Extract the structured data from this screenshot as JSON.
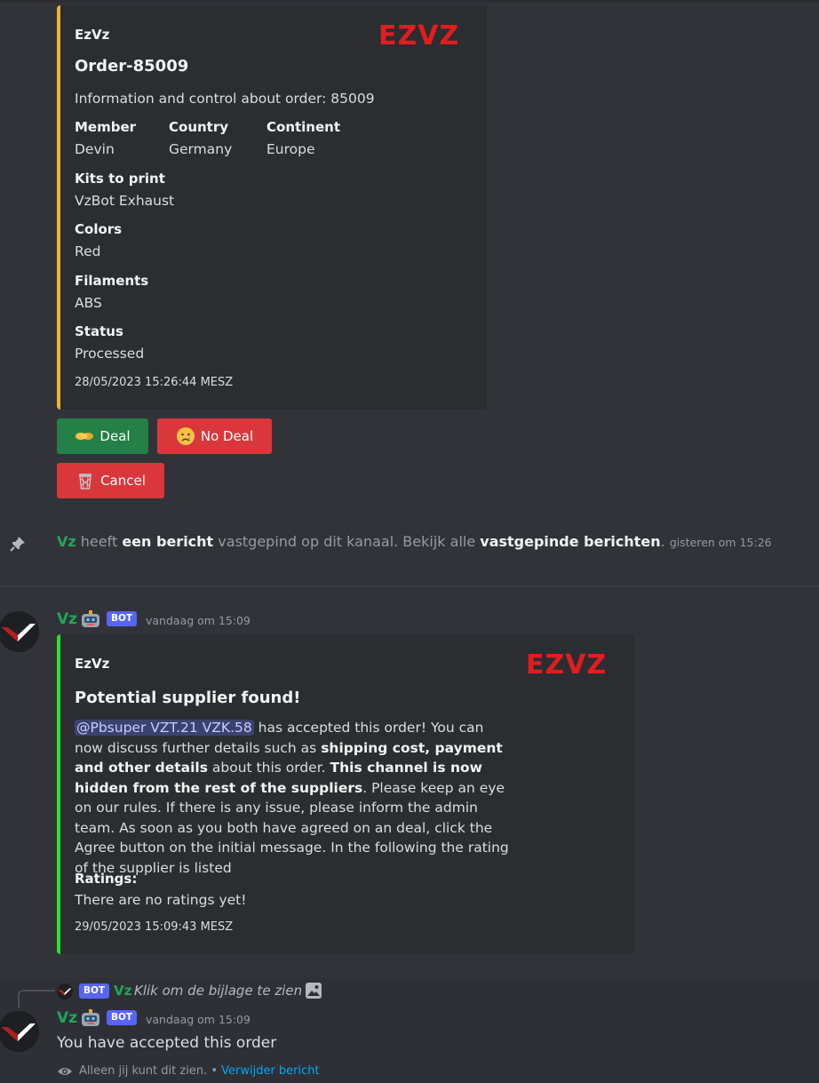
{
  "order_embed": {
    "author": "EzVz",
    "logo_text": "EZVZ",
    "title": "Order-85009",
    "description": "Information and control about order: 85009",
    "fields": {
      "member": {
        "name": "Member",
        "value": "Devin"
      },
      "country": {
        "name": "Country",
        "value": "Germany"
      },
      "continent": {
        "name": "Continent",
        "value": "Europe"
      },
      "kits": {
        "name": "Kits to print",
        "value": "VzBot Exhaust"
      },
      "colors": {
        "name": "Colors",
        "value": "Red"
      },
      "filaments": {
        "name": "Filaments",
        "value": "ABS"
      },
      "status": {
        "name": "Status",
        "value": "Processed"
      }
    },
    "footer": "28/05/2023 15:26:44 MESZ",
    "bar_color": "#f0b232"
  },
  "buttons": {
    "deal": "Deal",
    "no_deal": "No Deal",
    "cancel": "Cancel"
  },
  "pin_message": {
    "user": "Vz",
    "part1": " heeft ",
    "bold1": "een bericht",
    "part2": " vastgepind op dit kanaal. Bekijk alle ",
    "bold2": "vastgepinde berichten",
    "part3": ".",
    "timestamp": "gisteren om 15:26"
  },
  "message1": {
    "username": "Vz",
    "badge": "BOT",
    "timestamp": "vandaag om 15:09"
  },
  "supplier_embed": {
    "author": "EzVz",
    "logo_text": "EZVZ",
    "title": "Potential supplier found!",
    "mention": "@Pbsuper VZT.21 VZK.58",
    "text1": " has accepted this order! You can now discuss further details such as ",
    "bold1": "shipping cost, payment and other details",
    "text2": " about this order. ",
    "bold2": "This channel is now hidden from the rest of the suppliers",
    "text3": ". Please keep an eye on our rules. If there is any issue, please inform the admin team. As soon as you both have agreed on an deal, click the Agree button on the initial message. In the following the rating of the supplier is listed",
    "ratings_name": "Ratings:",
    "ratings_value": "There are no ratings yet!",
    "footer": "29/05/2023 15:09:43 MESZ",
    "bar_color": "#23e52b"
  },
  "reply": {
    "badge": "BOT",
    "username": "Vz",
    "text": "Klik om de bijlage te zien"
  },
  "message2": {
    "username": "Vz",
    "badge": "BOT",
    "timestamp": "vandaag om 15:09",
    "text": "You have accepted this order"
  },
  "ephemeral": {
    "text": "Alleen jij kunt dit zien.",
    "separator": " • ",
    "link": "Verwijder bericht"
  }
}
